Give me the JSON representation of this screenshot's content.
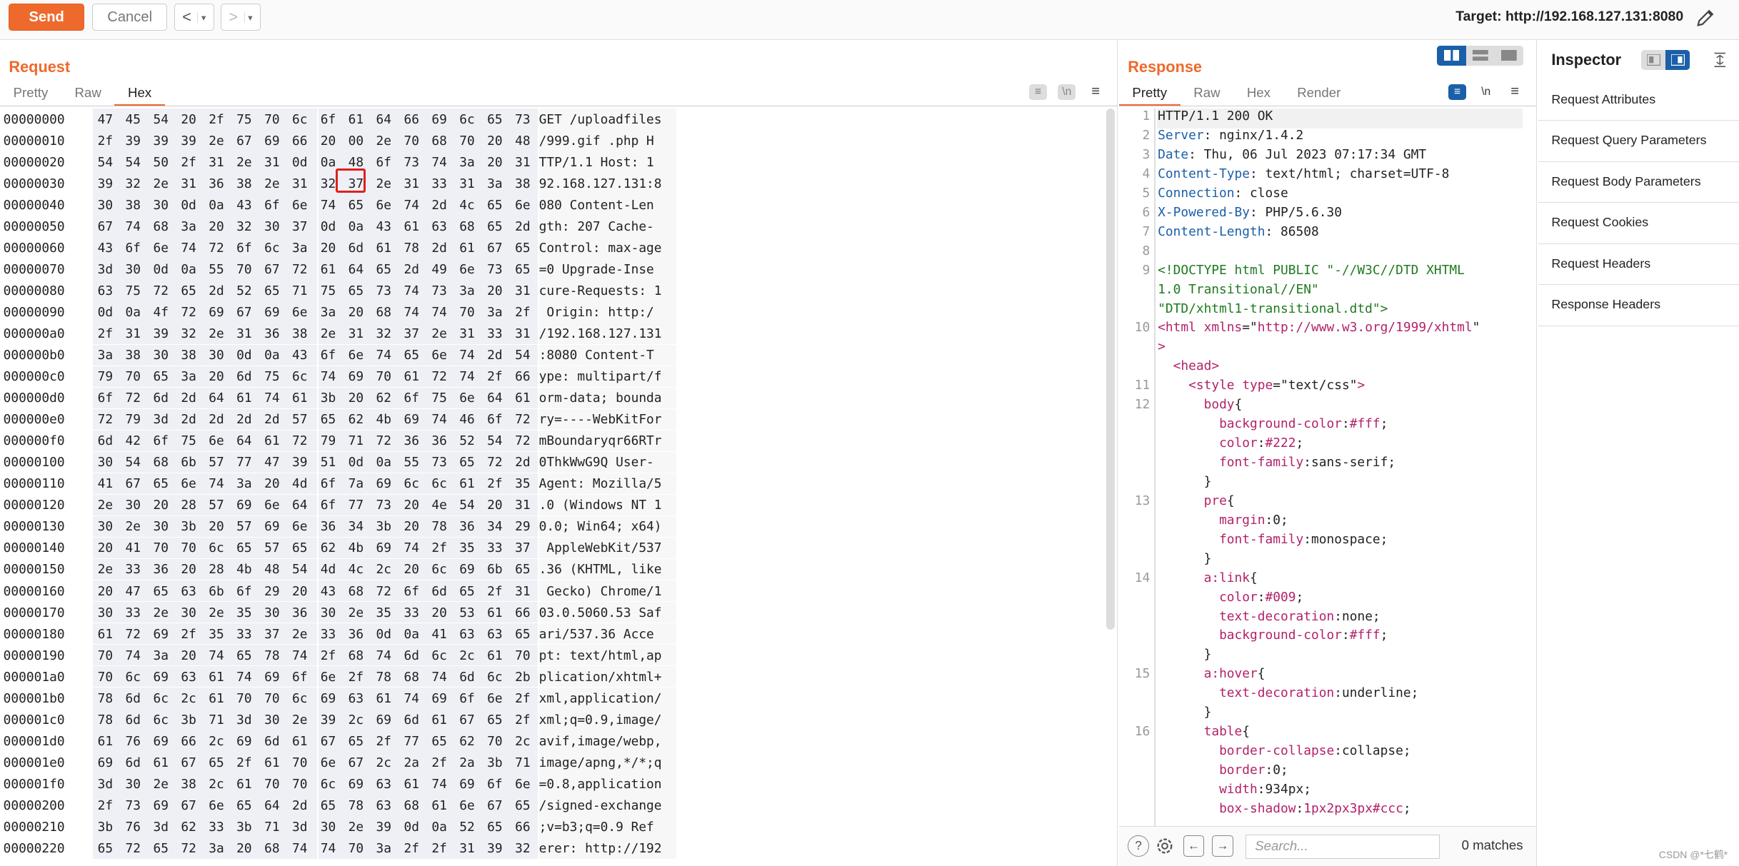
{
  "toolbar": {
    "send": "Send",
    "cancel": "Cancel",
    "back": "<",
    "forward": ">",
    "dropdown": "▾",
    "target": "Target: http://192.168.127.131:8080"
  },
  "request": {
    "title": "Request",
    "tabs": [
      "Pretty",
      "Raw",
      "Hex"
    ],
    "active_tab": "Hex",
    "newline_toggle": "\\n",
    "rows": [
      {
        "o": "00000000",
        "a": "47 45 54 20 2f 75 70 6c",
        "b": "6f 61 64 66 69 6c 65 73",
        "t": "GET /uploadfiles"
      },
      {
        "o": "00000010",
        "a": "2f 39 39 39 2e 67 69 66",
        "b": "20 00 2e 70 68 70 20 48",
        "t": "/999.gif .php H"
      },
      {
        "o": "00000020",
        "a": "54 54 50 2f 31 2e 31 0d",
        "b": "0a 48 6f 73 74 3a 20 31",
        "t": "TTP/1.1 Host: 1"
      },
      {
        "o": "00000030",
        "a": "39 32 2e 31 36 38 2e 31",
        "b": "32 37 2e 31 33 31 3a 38",
        "t": "92.168.127.131:8"
      },
      {
        "o": "00000040",
        "a": "30 38 30 0d 0a 43 6f 6e",
        "b": "74 65 6e 74 2d 4c 65 6e",
        "t": "080 Content-Len"
      },
      {
        "o": "00000050",
        "a": "67 74 68 3a 20 32 30 37",
        "b": "0d 0a 43 61 63 68 65 2d",
        "t": "gth: 207 Cache-"
      },
      {
        "o": "00000060",
        "a": "43 6f 6e 74 72 6f 6c 3a",
        "b": "20 6d 61 78 2d 61 67 65",
        "t": "Control: max-age"
      },
      {
        "o": "00000070",
        "a": "3d 30 0d 0a 55 70 67 72",
        "b": "61 64 65 2d 49 6e 73 65",
        "t": "=0 Upgrade-Inse"
      },
      {
        "o": "00000080",
        "a": "63 75 72 65 2d 52 65 71",
        "b": "75 65 73 74 73 3a 20 31",
        "t": "cure-Requests: 1"
      },
      {
        "o": "00000090",
        "a": "0d 0a 4f 72 69 67 69 6e",
        "b": "3a 20 68 74 74 70 3a 2f",
        "t": " Origin: http:/"
      },
      {
        "o": "000000a0",
        "a": "2f 31 39 32 2e 31 36 38",
        "b": "2e 31 32 37 2e 31 33 31",
        "t": "/192.168.127.131"
      },
      {
        "o": "000000b0",
        "a": "3a 38 30 38 30 0d 0a 43",
        "b": "6f 6e 74 65 6e 74 2d 54",
        "t": ":8080 Content-T"
      },
      {
        "o": "000000c0",
        "a": "79 70 65 3a 20 6d 75 6c",
        "b": "74 69 70 61 72 74 2f 66",
        "t": "ype: multipart/f"
      },
      {
        "o": "000000d0",
        "a": "6f 72 6d 2d 64 61 74 61",
        "b": "3b 20 62 6f 75 6e 64 61",
        "t": "orm-data; bounda"
      },
      {
        "o": "000000e0",
        "a": "72 79 3d 2d 2d 2d 2d 57",
        "b": "65 62 4b 69 74 46 6f 72",
        "t": "ry=----WebKitFor"
      },
      {
        "o": "000000f0",
        "a": "6d 42 6f 75 6e 64 61 72",
        "b": "79 71 72 36 36 52 54 72",
        "t": "mBoundaryqr66RTr"
      },
      {
        "o": "00000100",
        "a": "30 54 68 6b 57 77 47 39",
        "b": "51 0d 0a 55 73 65 72 2d",
        "t": "0ThkWwG9Q User-"
      },
      {
        "o": "00000110",
        "a": "41 67 65 6e 74 3a 20 4d",
        "b": "6f 7a 69 6c 6c 61 2f 35",
        "t": "Agent: Mozilla/5"
      },
      {
        "o": "00000120",
        "a": "2e 30 20 28 57 69 6e 64",
        "b": "6f 77 73 20 4e 54 20 31",
        "t": ".0 (Windows NT 1"
      },
      {
        "o": "00000130",
        "a": "30 2e 30 3b 20 57 69 6e",
        "b": "36 34 3b 20 78 36 34 29",
        "t": "0.0; Win64; x64)"
      },
      {
        "o": "00000140",
        "a": "20 41 70 70 6c 65 57 65",
        "b": "62 4b 69 74 2f 35 33 37",
        "t": " AppleWebKit/537"
      },
      {
        "o": "00000150",
        "a": "2e 33 36 20 28 4b 48 54",
        "b": "4d 4c 2c 20 6c 69 6b 65",
        "t": ".36 (KHTML, like"
      },
      {
        "o": "00000160",
        "a": "20 47 65 63 6b 6f 29 20",
        "b": "43 68 72 6f 6d 65 2f 31",
        "t": " Gecko) Chrome/1"
      },
      {
        "o": "00000170",
        "a": "30 33 2e 30 2e 35 30 36",
        "b": "30 2e 35 33 20 53 61 66",
        "t": "03.0.5060.53 Saf"
      },
      {
        "o": "00000180",
        "a": "61 72 69 2f 35 33 37 2e",
        "b": "33 36 0d 0a 41 63 63 65",
        "t": "ari/537.36 Acce"
      },
      {
        "o": "00000190",
        "a": "70 74 3a 20 74 65 78 74",
        "b": "2f 68 74 6d 6c 2c 61 70",
        "t": "pt: text/html,ap"
      },
      {
        "o": "000001a0",
        "a": "70 6c 69 63 61 74 69 6f",
        "b": "6e 2f 78 68 74 6d 6c 2b",
        "t": "plication/xhtml+"
      },
      {
        "o": "000001b0",
        "a": "78 6d 6c 2c 61 70 70 6c",
        "b": "69 63 61 74 69 6f 6e 2f",
        "t": "xml,application/"
      },
      {
        "o": "000001c0",
        "a": "78 6d 6c 3b 71 3d 30 2e",
        "b": "39 2c 69 6d 61 67 65 2f",
        "t": "xml;q=0.9,image/"
      },
      {
        "o": "000001d0",
        "a": "61 76 69 66 2c 69 6d 61",
        "b": "67 65 2f 77 65 62 70 2c",
        "t": "avif,image/webp,"
      },
      {
        "o": "000001e0",
        "a": "69 6d 61 67 65 2f 61 70",
        "b": "6e 67 2c 2a 2f 2a 3b 71",
        "t": "image/apng,*/*;q"
      },
      {
        "o": "000001f0",
        "a": "3d 30 2e 38 2c 61 70 70",
        "b": "6c 69 63 61 74 69 6f 6e",
        "t": "=0.8,application"
      },
      {
        "o": "00000200",
        "a": "2f 73 69 67 6e 65 64 2d",
        "b": "65 78 63 68 61 6e 67 65",
        "t": "/signed-exchange"
      },
      {
        "o": "00000210",
        "a": "3b 76 3d 62 33 3b 71 3d",
        "b": "30 2e 39 0d 0a 52 65 66",
        "t": ";v=b3;q=0.9 Ref"
      },
      {
        "o": "00000220",
        "a": "65 72 65 72 3a 20 68 74",
        "b": "74 70 3a 2f 2f 31 39 32",
        "t": "erer: http://192"
      }
    ]
  },
  "response": {
    "title": "Response",
    "tabs": [
      "Pretty",
      "Raw",
      "Hex",
      "Render"
    ],
    "active_tab": "Pretty",
    "newline_toggle": "\\n",
    "search_placeholder": "Search...",
    "matches": "0 matches"
  },
  "inspector": {
    "title": "Inspector",
    "items": [
      "Request Attributes",
      "Request Query Parameters",
      "Request Body Parameters",
      "Request Cookies",
      "Request Headers",
      "Response Headers"
    ]
  },
  "watermark": "CSDN @*七鹤*",
  "colors": {
    "accent": "#ee6a2c",
    "blue": "#1b5fa8",
    "highlight": "#e0201b"
  }
}
